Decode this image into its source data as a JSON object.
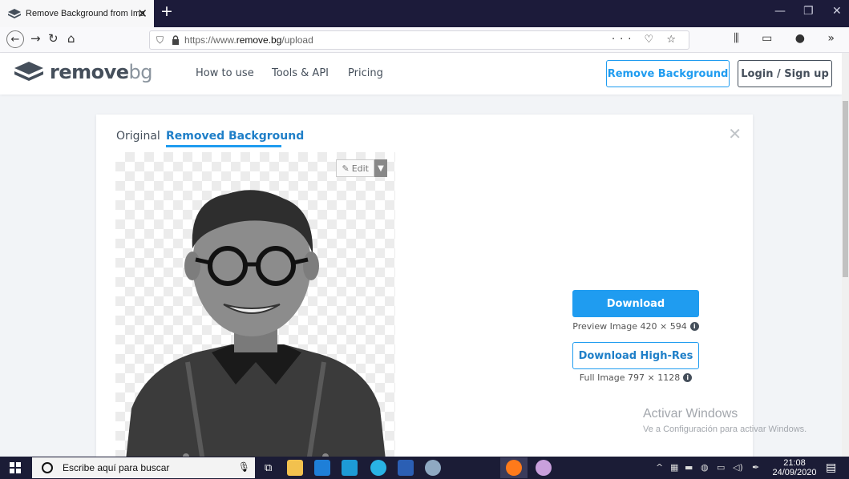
{
  "browser": {
    "tab_title": "Remove Background from Image",
    "url_prefix": "https://www.",
    "url_domain": "remove.bg",
    "url_path": "/upload",
    "url_actions": "··· ♡ ☆",
    "toolbar_icons": "⫼ ▭ ● »"
  },
  "site": {
    "logo_bold": "remove",
    "logo_light": "bg",
    "nav": [
      "How to use",
      "Tools & API",
      "Pricing"
    ],
    "cta_primary": "Remove Background",
    "cta_login": "Login / Sign up"
  },
  "card": {
    "tab_original": "Original",
    "tab_removed": "Removed Background",
    "edit_label": "Edit",
    "download_label": "Download",
    "preview_caption": "Preview Image 420 × 594",
    "download_hr_label": "Download High-Res",
    "full_caption": "Full Image 797 × 1128"
  },
  "watermark": {
    "title": "Activar Windows",
    "subtitle": "Ve a Configuración para activar Windows."
  },
  "taskbar": {
    "search_placeholder": "Escribe aquí para buscar",
    "time": "21:08",
    "date": "24/09/2020"
  },
  "colors": {
    "accent": "#1f9cf0",
    "text_dark": "#454f5b",
    "taskbar": "#1b1c36"
  }
}
